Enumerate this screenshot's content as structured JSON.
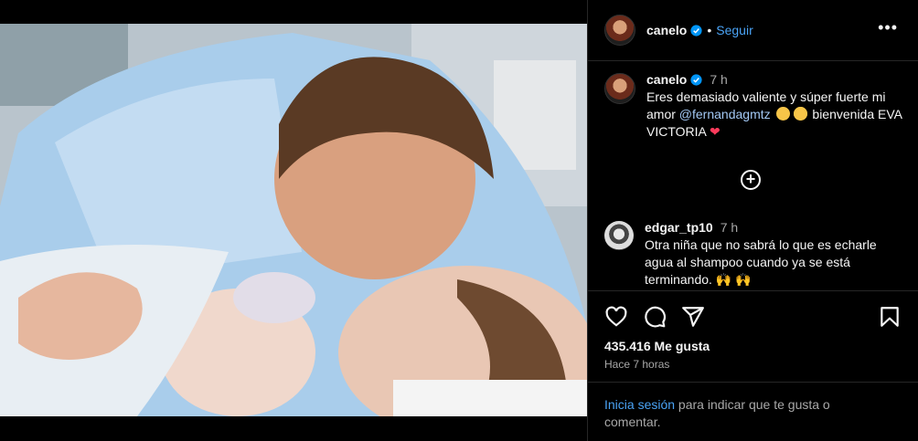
{
  "post": {
    "photo_name": "newborn-kiss-photo",
    "author": "canelo",
    "follow_label": "Seguir",
    "dot": "•",
    "more_label": "•••"
  },
  "caption": {
    "author": "canelo",
    "time": "7 h",
    "text_part1": "Eres demasiado valiente y súper fuerte mi amor ",
    "mention": "@fernandagmtz",
    "text_part2": " bienvenida EVA VICTORIA ",
    "heart": "❤"
  },
  "comments": [
    {
      "author": "edgar_tp10",
      "time": "7 h",
      "text": "Otra niña que no sabrá lo que es echarle agua al shampoo cuando ya se está terminando. 🙌 🙌"
    }
  ],
  "stats": {
    "likes": "435.416 Me gusta",
    "posted": "Hace 7 horas"
  },
  "login": {
    "link": "Inicia sesión",
    "rest": " para indicar que te gusta o comentar."
  },
  "icons": [
    "verified-badge-icon",
    "more-options-icon",
    "add-comment-icon",
    "heart-icon",
    "comment-icon",
    "share-icon",
    "save-icon"
  ],
  "colors": {
    "background": "#000000",
    "link": "#4aa3f5",
    "muted": "#a8a8a8",
    "verified": "#0095f6"
  }
}
